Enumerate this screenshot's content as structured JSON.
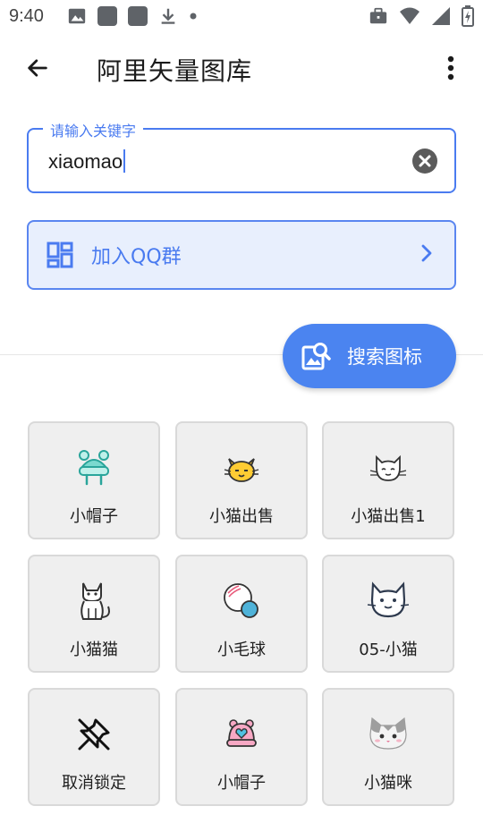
{
  "status_bar": {
    "time": "9:40",
    "left_icons": [
      "image-icon",
      "app-square-icon",
      "app-square-icon",
      "download-icon",
      "dot-icon"
    ],
    "right_icons": [
      "briefcase-icon",
      "wifi-icon",
      "signal-icon",
      "battery-icon"
    ]
  },
  "app_bar": {
    "title": "阿里矢量图库",
    "back_icon": "arrow-back-icon",
    "menu_icon": "more-vert-icon"
  },
  "search": {
    "label": "请输入关键字",
    "value": "xiaomao",
    "clear_icon": "clear-circle-icon"
  },
  "qq_banner": {
    "label": "加入QQ群",
    "icon": "dashboard-grid-icon",
    "chevron": "chevron-right-icon"
  },
  "fab": {
    "label": "搜索图标",
    "icon": "image-search-icon"
  },
  "results": [
    {
      "name": "小帽子",
      "icon": "hat-teal-icon"
    },
    {
      "name": "小猫出售",
      "icon": "cat-face-yellow-icon"
    },
    {
      "name": "小猫出售1",
      "icon": "cat-face-outline-icon"
    },
    {
      "name": "小猫猫",
      "icon": "sitting-cat-icon"
    },
    {
      "name": "小毛球",
      "icon": "yarn-ball-icon"
    },
    {
      "name": "05-小猫",
      "icon": "cat-head-outline-icon"
    },
    {
      "name": "取消锁定",
      "icon": "unpin-icon"
    },
    {
      "name": "小帽子",
      "icon": "hat-pink-heart-icon"
    },
    {
      "name": "小猫咪",
      "icon": "kitten-grey-icon"
    }
  ],
  "colors": {
    "accent": "#4a7bf0",
    "banner_bg": "#e8effd",
    "fab_bg": "#4b84f0",
    "card_bg": "#efefef"
  }
}
